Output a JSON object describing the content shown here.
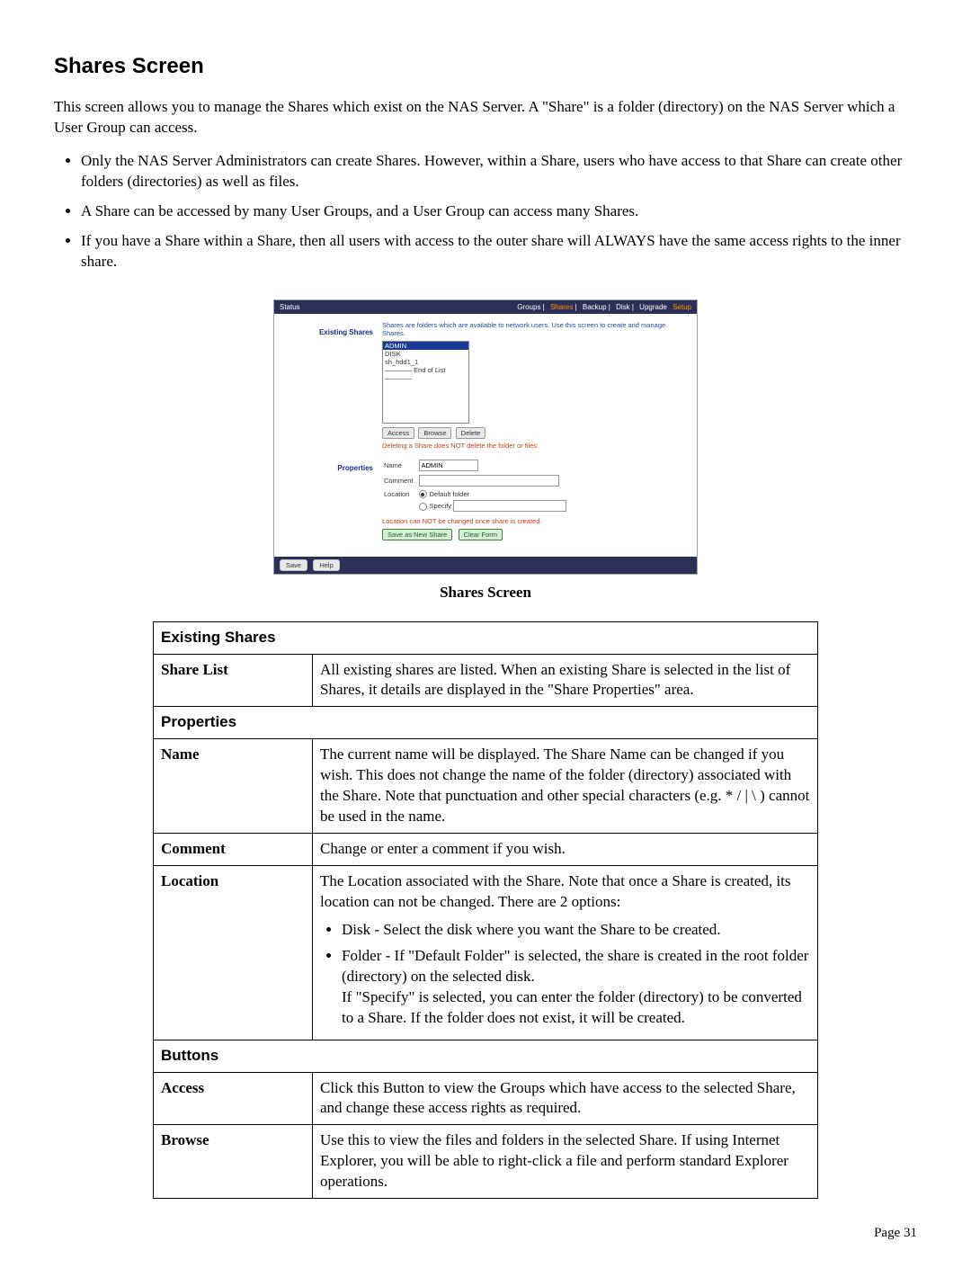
{
  "title": "Shares Screen",
  "intro": "This screen allows you to manage the Shares which exist on the NAS Server. A \"Share\" is a folder (directory) on the NAS Server which a User Group can access.",
  "bullets": [
    "Only the NAS Server Administrators can create Shares. However, within a Share, users who have access to that Share can create other folders (directories) as well as files.",
    "A Share can be accessed by many User Groups, and a User Group can access many Shares.",
    "If you have a Share within a Share, then all users with access to the outer share will ALWAYS have the same access rights to the inner share."
  ],
  "fig": {
    "left_title": "Status",
    "nav": [
      "Groups",
      "Shares",
      "Backup",
      "Disk",
      "Upgrade",
      "Setup"
    ],
    "nav_active_index": 1,
    "note": "Shares are folders which are available to network users. Use this screen to create and manage Shares.",
    "left_label_existing": "Existing Shares",
    "left_label_props": "Properties",
    "list": [
      "ADMIN",
      "DISK",
      "sh_hdd1_1",
      "———— End of List ————"
    ],
    "btn_access": "Access",
    "btn_browse": "Browse",
    "btn_delete": "Delete",
    "delete_warn": "Deleting a Share does NOT delete the folder or files.",
    "prop_name_lbl": "Name",
    "prop_name_val": "ADMIN",
    "prop_comment_lbl": "Comment",
    "prop_location_lbl": "Location",
    "loc_default": "Default folder",
    "loc_specify": "Specify",
    "loc_note": "Location can NOT be changed once share is created.",
    "btn_save_new": "Save as New Share",
    "btn_clear": "Clear Form",
    "btn_save": "Save",
    "btn_help": "Help"
  },
  "caption": "Shares Screen",
  "table": {
    "section1": "Existing Shares",
    "row_share_list_label": "Share List",
    "row_share_list_text": "All existing shares are listed. When an existing Share is selected in the list of Shares, it details are displayed in the \"Share Properties\" area.",
    "section2": "Properties",
    "row_name_label": "Name",
    "row_name_text": "The current name will be displayed. The Share Name can be changed if you wish. This does not change the name of the folder (directory) associated with the Share. Note that punctuation and other special characters (e.g. * / | \\ ) cannot be used in the name.",
    "row_comment_label": "Comment",
    "row_comment_text": "Change or enter a comment if you wish.",
    "row_location_label": "Location",
    "row_location_intro": "The Location associated with the Share. Note that once a Share is created, its location can not be changed. There are 2 options:",
    "row_location_item1": "Disk - Select the disk where you want the Share to be created.",
    "row_location_item2a": "Folder - If \"Default Folder\" is selected, the share is created in the root folder (directory) on the selected disk.",
    "row_location_item2b": "If \"Specify\" is selected, you can enter the folder (directory) to be converted to a Share. If the folder does not exist, it will be created.",
    "section3": "Buttons",
    "row_access_label": "Access",
    "row_access_text": "Click this Button to view the Groups which have access to the selected Share, and change these access rights as required.",
    "row_browse_label": "Browse",
    "row_browse_text": "Use this to view the files and folders in the selected Share. If using Internet Explorer, you will be able to right-click a file and perform standard Explorer operations."
  },
  "page_number": "Page 31"
}
